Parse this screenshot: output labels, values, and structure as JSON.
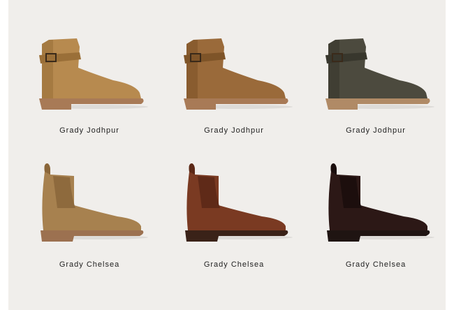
{
  "products": [
    {
      "name": "Grady Jodhpur",
      "style": "jodhpur",
      "color": "#b78a4f",
      "shade": "#9a6f38",
      "sole": "#a87a56"
    },
    {
      "name": "Grady Jodhpur",
      "style": "jodhpur",
      "color": "#9a6a3a",
      "shade": "#7e5428",
      "sole": "#a87a56"
    },
    {
      "name": "Grady Jodhpur",
      "style": "jodhpur",
      "color": "#4c4a3e",
      "shade": "#38372d",
      "sole": "#b08a66"
    },
    {
      "name": "Grady Chelsea",
      "style": "chelsea",
      "color": "#a7814f",
      "shade": "#8a6639",
      "sole": "#9c7150"
    },
    {
      "name": "Grady Chelsea",
      "style": "chelsea",
      "color": "#7a3a22",
      "shade": "#5b2816",
      "sole": "#3a2218"
    },
    {
      "name": "Grady Chelsea",
      "style": "chelsea",
      "color": "#2c1816",
      "shade": "#1a0d0c",
      "sole": "#1f1412"
    }
  ]
}
